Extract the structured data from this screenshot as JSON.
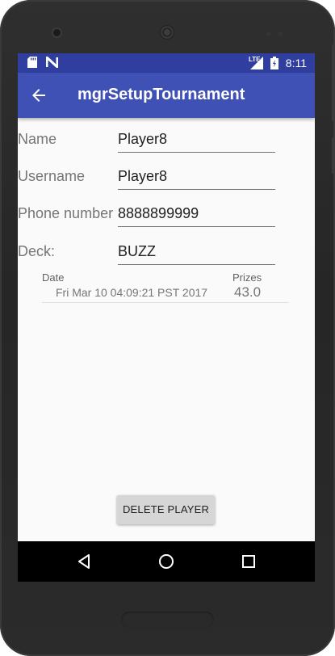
{
  "status_bar": {
    "time": "8:11",
    "network": "LTE",
    "icons": [
      "sd-card-icon",
      "n-logo-icon",
      "signal-icon",
      "battery-icon"
    ]
  },
  "app_bar": {
    "title": "mgrSetupTournament",
    "back_icon": "back-arrow-icon"
  },
  "form": {
    "fields": [
      {
        "label": "Name",
        "value": "Player8"
      },
      {
        "label": "Username",
        "value": "Player8"
      },
      {
        "label": "Phone number",
        "value": "8888899999"
      },
      {
        "label": "Deck:",
        "value": "BUZZ"
      }
    ]
  },
  "history": {
    "date_header": "Date",
    "prizes_header": "Prizes",
    "rows": [
      {
        "date": "Fri Mar 10 04:09:21 PST 2017",
        "prizes": "43.0"
      }
    ]
  },
  "delete_button": {
    "label": "DELETE PLAYER"
  },
  "nav": {
    "icons": [
      "back-triangle-icon",
      "home-circle-icon",
      "recents-square-icon"
    ]
  },
  "colors": {
    "primary": "#3f51b5",
    "primary_dark": "#303f9f",
    "background": "#fafafa",
    "navbar": "#000000"
  }
}
